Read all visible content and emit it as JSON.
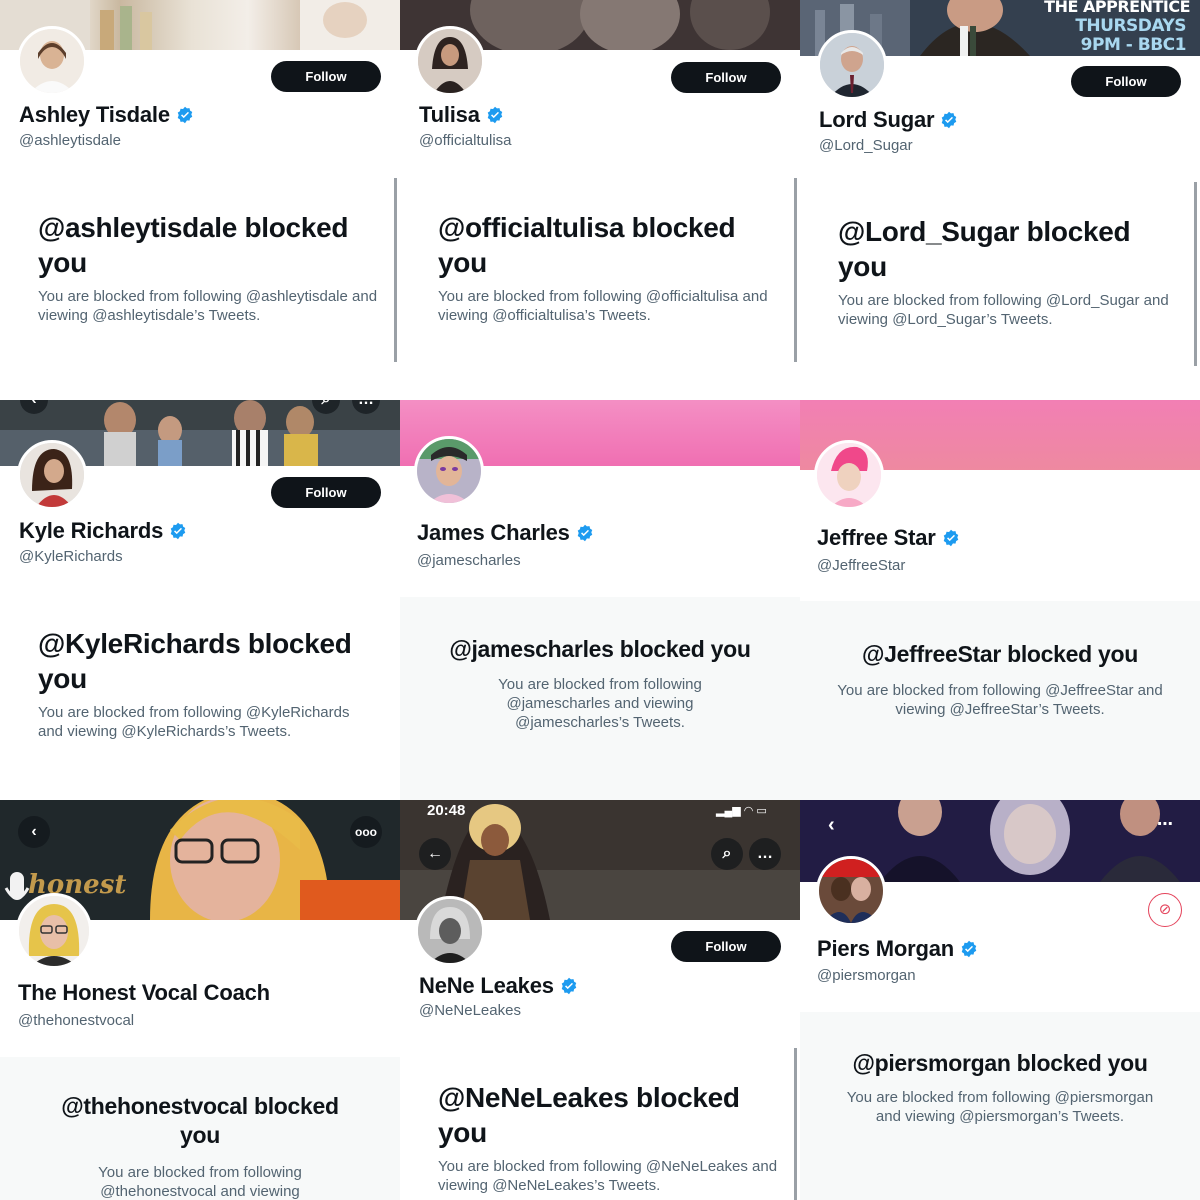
{
  "profiles": [
    {
      "display_name": "Ashley Tisdale",
      "handle": "@ashleytisdale",
      "follow_label": "Follow",
      "block_title": "@ashleytisdale blocked you",
      "block_desc": "You are blocked from following @ashleytisdale and viewing @ashleytisdale’s Tweets."
    },
    {
      "display_name": "Tulisa",
      "handle": "@officialtulisa",
      "follow_label": "Follow",
      "block_title": "@officialtulisa blocked you",
      "block_desc": "You are blocked from following @officialtulisa and viewing @officialtulisa’s Tweets."
    },
    {
      "display_name": "Lord Sugar",
      "handle": "@Lord_Sugar",
      "follow_label": "Follow",
      "banner_text_1": "THE APPRENTICE",
      "banner_text_2": "THURSDAYS",
      "banner_text_3": "9PM - BBC1",
      "block_title": "@Lord_Sugar blocked you",
      "block_desc": "You are blocked from following @Lord_Sugar and viewing @Lord_Sugar’s Tweets."
    },
    {
      "display_name": "Kyle Richards",
      "handle": "@KyleRichards",
      "follow_label": "Follow",
      "block_title": "@KyleRichards blocked you",
      "block_desc": "You are blocked from following @KyleRichards and viewing @KyleRichards’s Tweets."
    },
    {
      "display_name": "James Charles",
      "handle": "@jamescharles",
      "block_title": "@jamescharles blocked you",
      "block_desc": "You are blocked from following @jamescharles and viewing @jamescharles’s Tweets."
    },
    {
      "display_name": "Jeffree Star",
      "handle": "@JeffreeStar",
      "block_title": "@JeffreeStar blocked you",
      "block_desc": "You are blocked from following @JeffreeStar and viewing @JeffreeStar’s Tweets."
    },
    {
      "display_name": "The Honest Vocal Coach",
      "handle": "@thehonestvocal",
      "banner_text": "honest",
      "block_title": "@thehonestvocal blocked you",
      "block_desc": "You are blocked from following @thehonestvocal and viewing"
    },
    {
      "display_name": "NeNe Leakes",
      "handle": "@NeNeLeakes",
      "follow_label": "Follow",
      "status_time": "20:48",
      "block_title": "@NeNeLeakes blocked you",
      "block_desc": "You are blocked from following @NeNeLeakes and viewing @NeNeLeakes’s Tweets."
    },
    {
      "display_name": "Piers Morgan",
      "handle": "@piersmorgan",
      "block_title": "@piersmorgan blocked you",
      "block_desc": "You are blocked from following @piersmorgan and viewing @piersmorgan’s Tweets."
    }
  ],
  "icons": {
    "verified": "verified-badge-icon",
    "back": "back-arrow-icon",
    "more": "more-options-icon",
    "search": "search-icon",
    "muted": "muted-notifications-icon"
  },
  "colors": {
    "verified_blue": "#1d9bf0",
    "pink_banner": "#f27fb4",
    "button_dark": "#0f1419",
    "secondary_text": "#536471"
  }
}
